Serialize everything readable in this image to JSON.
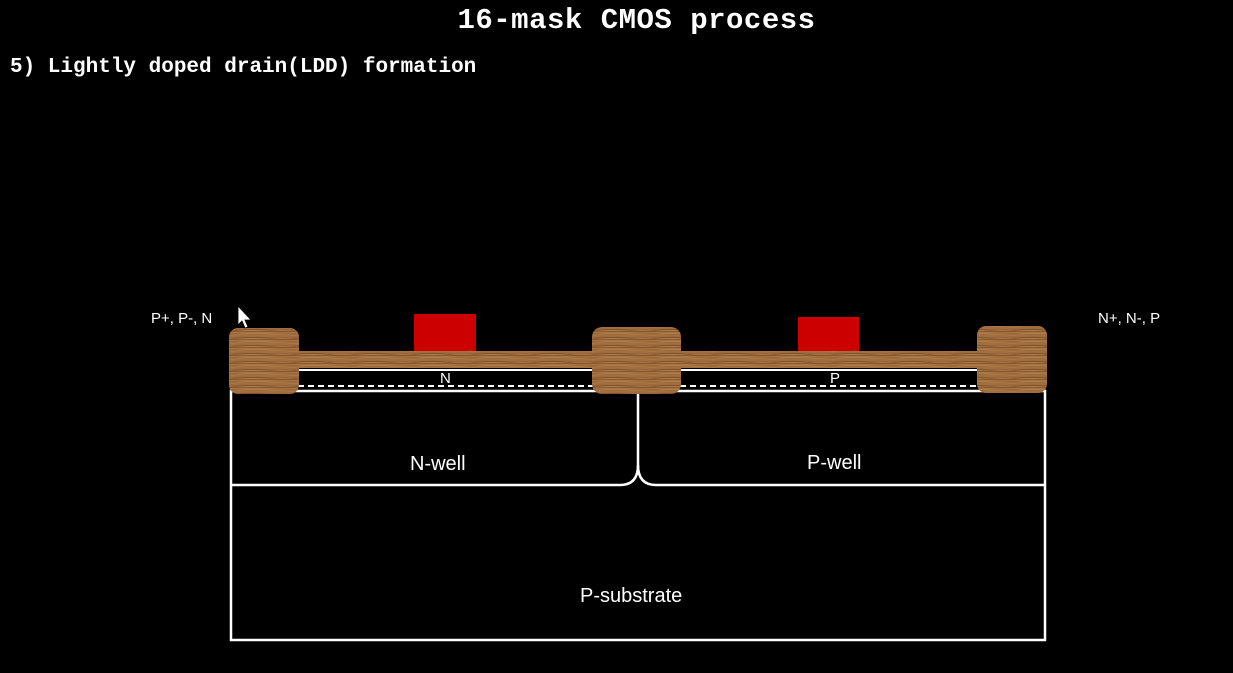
{
  "title": "16-mask CMOS process",
  "step": "5) Lightly doped drain(LDD) formation",
  "left_implant_label": "P+, P-, N",
  "right_implant_label": "N+, N-, P",
  "nwell_channel_label": "N",
  "pwell_channel_label": "P",
  "nwell_label": "N-well",
  "pwell_label": "P-well",
  "substrate_label": "P-substrate",
  "colors": {
    "background": "#000000",
    "gate": "#cc0000",
    "oxide": "#a86b3a",
    "outline": "#ffffff"
  }
}
